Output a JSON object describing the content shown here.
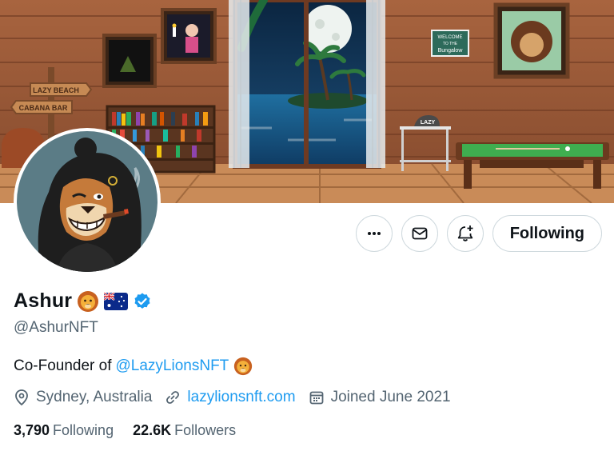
{
  "banner": {
    "signs": [
      "LAZY BEACH",
      "CABANA BAR"
    ],
    "frame_sign": [
      "WELCOME",
      "TO THE",
      "Bungalow"
    ],
    "stool_label": "LAZY"
  },
  "profile": {
    "display_name": "Ashur",
    "handle": "@AshurNFT",
    "verified": true,
    "bio_text": "Co-Founder of",
    "bio_mention": "@LazyLionsNFT",
    "location": "Sydney, Australia",
    "website": "lazylionsnft.com",
    "joined": "Joined June 2021"
  },
  "stats": {
    "following_count": "3,790",
    "following_label": "Following",
    "followers_count": "22.6K",
    "followers_label": "Followers"
  },
  "actions": {
    "follow_label": "Following"
  },
  "icons": [
    "more-icon",
    "mail-icon",
    "bell-plus-icon",
    "verified-badge-icon",
    "location-icon",
    "link-icon",
    "calendar-icon",
    "lion-emoji-icon",
    "australia-flag-icon"
  ],
  "colors": {
    "accent": "#1d9bf0",
    "muted": "#536471",
    "text": "#0f1419",
    "border": "#cfd9de"
  }
}
